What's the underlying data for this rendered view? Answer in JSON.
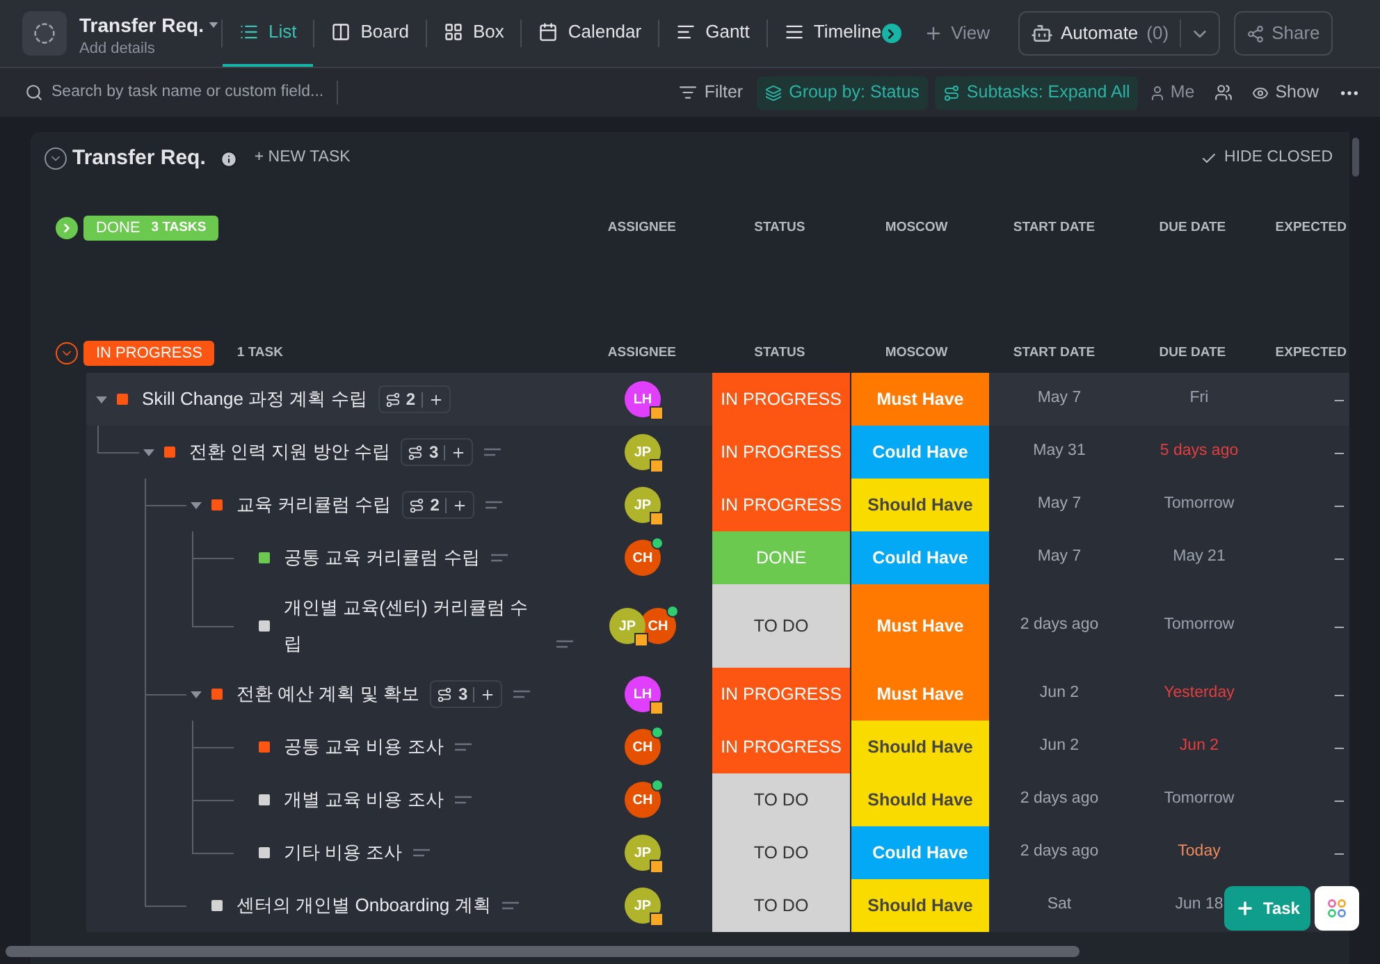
{
  "header": {
    "title": "Transfer Req.",
    "subtitle": "Add details"
  },
  "views": [
    {
      "label": "List",
      "selected": true,
      "kind": "list"
    },
    {
      "label": "Board",
      "selected": false,
      "kind": "board"
    },
    {
      "label": "Box",
      "selected": false,
      "kind": "box"
    },
    {
      "label": "Calendar",
      "selected": false,
      "kind": "calendar"
    },
    {
      "label": "Gantt",
      "selected": false,
      "kind": "gantt"
    },
    {
      "label": "Timeline",
      "selected": false,
      "kind": "timeline"
    }
  ],
  "add_view": "View",
  "automate": {
    "label": "Automate",
    "count": "(0)"
  },
  "share": "Share",
  "toolbar": {
    "search_placeholder": "Search by task name or custom field...",
    "filter": "Filter",
    "group_by": "Group by: Status",
    "subtasks": "Subtasks: Expand All",
    "me": "Me",
    "show": "Show"
  },
  "list": {
    "title": "Transfer Req.",
    "new_task": "+ NEW TASK",
    "hide_closed": "HIDE CLOSED"
  },
  "groups": [
    {
      "label": "DONE",
      "count": "3 TASKS",
      "color": "#6bc950",
      "expanded": false,
      "columns": [
        "ASSIGNEE",
        "STATUS",
        "MOSCOW",
        "START DATE",
        "DUE DATE",
        "EXPECTED"
      ]
    },
    {
      "label": "IN PROGRESS",
      "count": "1 TASK",
      "color": "#fd5512",
      "expanded": true,
      "columns": [
        "ASSIGNEE",
        "STATUS",
        "MOSCOW",
        "START DATE",
        "DUE DATE",
        "EXPECTED"
      ],
      "tasks": [
        {
          "name": "Skill Change 과정 계획 수립",
          "color": "#fd5512",
          "expanded": true,
          "subtasks": "2",
          "has_description": false,
          "assignees": [
            {
              "initials": "LH",
              "color": "#e040fb",
              "kind": "task"
            }
          ],
          "status": {
            "label": "IN PROGRESS",
            "color": "#fd5512"
          },
          "moscow": {
            "label": "Must Have",
            "color": "#ff7800"
          },
          "start": "May 7",
          "due": {
            "label": "Fri",
            "color": "#9ca3af"
          },
          "expected": "–",
          "children": [
            {
              "name": "전환 인력 지원 방안 수립",
              "color": "#fd5512",
              "expanded": true,
              "subtasks": "3",
              "has_description": true,
              "assignees": [
                {
                  "initials": "JP",
                  "color": "#afb42b",
                  "kind": "task"
                }
              ],
              "status": {
                "label": "IN PROGRESS",
                "color": "#fd5512"
              },
              "moscow": {
                "label": "Could Have",
                "color": "#03a9f4"
              },
              "start": "May 31",
              "due": {
                "label": "5 days ago",
                "color": "#e53e3e"
              },
              "expected": "–",
              "children": [
                {
                  "name": "교육 커리큘럼 수립",
                  "color": "#fd5512",
                  "expanded": true,
                  "subtasks": "2",
                  "has_description": true,
                  "assignees": [
                    {
                      "initials": "JP",
                      "color": "#afb42b",
                      "kind": "task"
                    }
                  ],
                  "status": {
                    "label": "IN PROGRESS",
                    "color": "#fd5512"
                  },
                  "moscow": {
                    "label": "Should Have",
                    "color": "#fadb00"
                  },
                  "start": "May 7",
                  "due": {
                    "label": "Tomorrow",
                    "color": "#9ca3af"
                  },
                  "expected": "–",
                  "children": [
                    {
                      "name": "공통 교육 커리큘럼 수립",
                      "color": "#6bc950",
                      "has_description": true,
                      "assignees": [
                        {
                          "initials": "CH",
                          "color": "#e65100",
                          "kind": "online"
                        }
                      ],
                      "status": {
                        "label": "DONE",
                        "color": "#6bc950"
                      },
                      "moscow": {
                        "label": "Could Have",
                        "color": "#03a9f4"
                      },
                      "start": "May 7",
                      "due": {
                        "label": "May 21",
                        "color": "#9ca3af"
                      },
                      "expected": "–"
                    },
                    {
                      "name": "개인별 교육(센터) 커리큘럼 수립",
                      "color": "#d3d3d3",
                      "has_description": true,
                      "assignees": [
                        {
                          "initials": "JP",
                          "color": "#afb42b",
                          "kind": "task"
                        },
                        {
                          "initials": "CH",
                          "color": "#e65100",
                          "kind": "online"
                        }
                      ],
                      "status": {
                        "label": "TO DO",
                        "color": "#d3d3d3"
                      },
                      "moscow": {
                        "label": "Must Have",
                        "color": "#ff7800"
                      },
                      "start": "2 days ago",
                      "due": {
                        "label": "Tomorrow",
                        "color": "#9ca3af"
                      },
                      "expected": "–"
                    }
                  ]
                },
                {
                  "name": "전환 예산 계획 및 확보",
                  "color": "#fd5512",
                  "expanded": true,
                  "subtasks": "3",
                  "has_description": true,
                  "assignees": [
                    {
                      "initials": "LH",
                      "color": "#e040fb",
                      "kind": "task"
                    }
                  ],
                  "status": {
                    "label": "IN PROGRESS",
                    "color": "#fd5512"
                  },
                  "moscow": {
                    "label": "Must Have",
                    "color": "#ff7800"
                  },
                  "start": "Jun 2",
                  "due": {
                    "label": "Yesterday",
                    "color": "#e53e3e"
                  },
                  "expected": "–",
                  "children": [
                    {
                      "name": "공통 교육 비용 조사",
                      "color": "#fd5512",
                      "has_description": true,
                      "assignees": [
                        {
                          "initials": "CH",
                          "color": "#e65100",
                          "kind": "online"
                        }
                      ],
                      "status": {
                        "label": "IN PROGRESS",
                        "color": "#fd5512"
                      },
                      "moscow": {
                        "label": "Should Have",
                        "color": "#fadb00"
                      },
                      "start": "Jun 2",
                      "due": {
                        "label": "Jun 2",
                        "color": "#e53e3e"
                      },
                      "expected": "–"
                    },
                    {
                      "name": "개별 교육 비용 조사",
                      "color": "#d3d3d3",
                      "has_description": true,
                      "assignees": [
                        {
                          "initials": "CH",
                          "color": "#e65100",
                          "kind": "online"
                        }
                      ],
                      "status": {
                        "label": "TO DO",
                        "color": "#d3d3d3"
                      },
                      "moscow": {
                        "label": "Should Have",
                        "color": "#fadb00"
                      },
                      "start": "2 days ago",
                      "due": {
                        "label": "Tomorrow",
                        "color": "#9ca3af"
                      },
                      "expected": "–"
                    },
                    {
                      "name": "기타 비용 조사",
                      "color": "#d3d3d3",
                      "has_description": true,
                      "assignees": [
                        {
                          "initials": "JP",
                          "color": "#afb42b",
                          "kind": "task"
                        }
                      ],
                      "status": {
                        "label": "TO DO",
                        "color": "#d3d3d3"
                      },
                      "moscow": {
                        "label": "Could Have",
                        "color": "#03a9f4"
                      },
                      "start": "2 days ago",
                      "due": {
                        "label": "Today",
                        "color": "#f08a5d"
                      },
                      "expected": "–"
                    }
                  ]
                },
                {
                  "name": "센터의 개인별 Onboarding 계획",
                  "color": "#d3d3d3",
                  "has_description": true,
                  "assignees": [
                    {
                      "initials": "JP",
                      "color": "#afb42b",
                      "kind": "task"
                    }
                  ],
                  "status": {
                    "label": "TO DO",
                    "color": "#d3d3d3"
                  },
                  "moscow": {
                    "label": "Should Have",
                    "color": "#fadb00"
                  },
                  "start": "Sat",
                  "due": {
                    "label": "Jun 18",
                    "color": "#9ca3af"
                  }
                }
              ]
            }
          ]
        }
      ]
    }
  ],
  "fab": {
    "label": "Task"
  }
}
